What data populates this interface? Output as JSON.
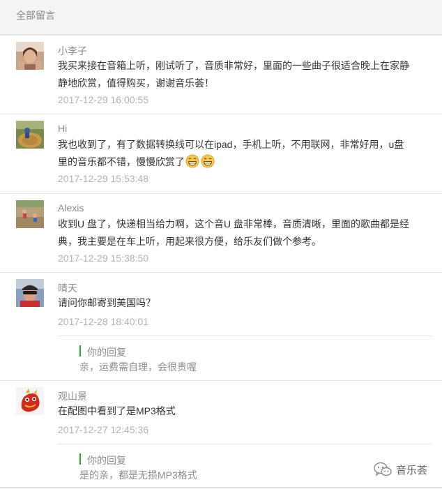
{
  "header": {
    "title": "全部留言"
  },
  "comments": [
    {
      "nickname": "小李子",
      "lines": [
        "我买来接在音箱上听，刚试听了，音质非常好，里面的一些曲子很适合晚上在家静",
        "静地欣赏，值得购买，谢谢音乐荟！"
      ],
      "time": "2017-12-29 16:00:55",
      "avatar_icon": "woman-portrait-avatar"
    },
    {
      "nickname": "Hi",
      "lines": [
        "我也收到了，有了数据转换线可以在ipad，手机上听，不用联网，非常好用，u盘",
        "里的音乐都不错，慢慢欣赏了"
      ],
      "emojis": [
        "grin-emoji",
        "grin-emoji"
      ],
      "time": "2017-12-29 15:53:48",
      "avatar_icon": "hay-bale-photo-avatar"
    },
    {
      "nickname": "Alexis",
      "lines": [
        "收到U 盘了，快递相当给力啊，这个音U 盘非常棒，音质清晰，里面的歌曲都是经",
        "典，我主要是在车上听，用起来很方便，给乐友们做个参考。"
      ],
      "time": "2017-12-29 15:38:50",
      "avatar_icon": "kids-playing-photo-avatar"
    },
    {
      "nickname": "晴天",
      "lines": [
        "请问你邮寄到美国吗？"
      ],
      "time": "2017-12-28 18:40:01",
      "avatar_icon": "man-sunglasses-avatar",
      "reply": {
        "label": "你的回复",
        "text": "亲，运费需自理，会很贵喔"
      }
    },
    {
      "nickname": "观山景",
      "lines": [
        "在配图中看到了是MP3格式"
      ],
      "time": "2017-12-27 12:45:36",
      "avatar_icon": "red-dragon-avatar",
      "reply": {
        "label": "你的回复",
        "text": "是的亲，都是无损MP3格式"
      }
    }
  ],
  "watermark": {
    "text": "音乐荟",
    "icon": "wechat-icon"
  },
  "colors": {
    "accent": "#1aad19",
    "text": "#333333",
    "muted": "#8c8c8c",
    "time": "#b2b2b2"
  }
}
